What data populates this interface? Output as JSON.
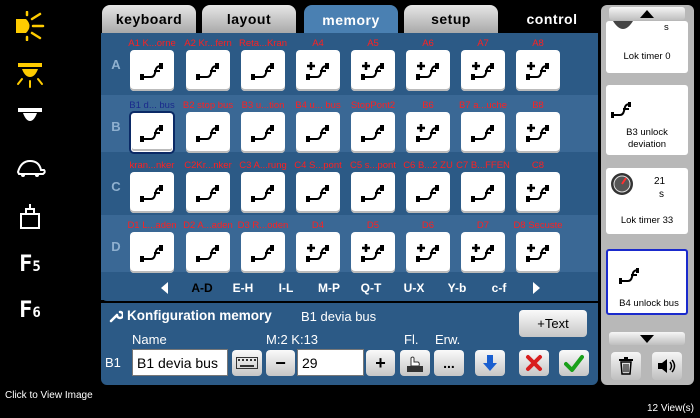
{
  "tabs": [
    {
      "label": "keyboard",
      "active": false
    },
    {
      "label": "layout",
      "active": false
    },
    {
      "label": "memory",
      "active": true
    },
    {
      "label": "setup",
      "active": false
    },
    {
      "label": "control",
      "active": false
    }
  ],
  "left_functions": [
    {
      "icon": "headlight-icon"
    },
    {
      "icon": "ceiling-light-icon"
    },
    {
      "icon": "lamp-icon"
    },
    {
      "icon": "turtle-icon"
    },
    {
      "icon": "weight-icon"
    },
    {
      "label": "F",
      "sub": "5"
    },
    {
      "label": "F",
      "sub": "6"
    }
  ],
  "rows": [
    {
      "letter": "A",
      "cells": [
        {
          "label": "A1 K...orne",
          "icon": "turnout"
        },
        {
          "label": "A2 Kr...fern",
          "icon": "turnout"
        },
        {
          "label": "Reta...Kran",
          "icon": "turnout"
        },
        {
          "label": "A4",
          "icon": "turnout-plus"
        },
        {
          "label": "A5",
          "icon": "turnout-plus"
        },
        {
          "label": "A6",
          "icon": "turnout-plus"
        },
        {
          "label": "A7",
          "icon": "turnout-plus"
        },
        {
          "label": "A8",
          "icon": "turnout-plus"
        }
      ]
    },
    {
      "letter": "B",
      "cells": [
        {
          "label": "B1 d... bus",
          "icon": "turnout",
          "selected": true
        },
        {
          "label": "B2 stop bus",
          "icon": "turnout"
        },
        {
          "label": "B3 u...tion",
          "icon": "turnout"
        },
        {
          "label": "B4 u... bus",
          "icon": "turnout"
        },
        {
          "label": "StopPont2",
          "icon": "turnout"
        },
        {
          "label": "B6",
          "icon": "turnout-plus"
        },
        {
          "label": "B7 a...uche",
          "icon": "turnout"
        },
        {
          "label": "B8",
          "icon": "turnout-plus"
        }
      ]
    },
    {
      "letter": "C",
      "cells": [
        {
          "label": "kran...nker",
          "icon": "turnout"
        },
        {
          "label": "C2Kr...nker",
          "icon": "turnout"
        },
        {
          "label": "C3 A...rung",
          "icon": "turnout"
        },
        {
          "label": "C4 S...pont",
          "icon": "turnout"
        },
        {
          "label": "C5 s...pont",
          "icon": "turnout"
        },
        {
          "label": "C6 B...2 ZU",
          "icon": "turnout"
        },
        {
          "label": "C7 B...FFEN",
          "icon": "turnout"
        },
        {
          "label": "C8",
          "icon": "turnout-plus"
        }
      ]
    },
    {
      "letter": "D",
      "cells": [
        {
          "label": "D1 L...aden",
          "icon": "turnout"
        },
        {
          "label": "D2 A...aden",
          "icon": "turnout"
        },
        {
          "label": "D3 R...oden",
          "icon": "turnout"
        },
        {
          "label": "D4",
          "icon": "turnout-plus"
        },
        {
          "label": "D5",
          "icon": "turnout-plus"
        },
        {
          "label": "D6",
          "icon": "turnout-plus"
        },
        {
          "label": "D7",
          "icon": "turnout-plus"
        },
        {
          "label": "D8 Secuste",
          "icon": "turnout-plus"
        }
      ]
    }
  ],
  "pages": [
    "A-D",
    "E-H",
    "I-L",
    "M-P",
    "Q-T",
    "U-X",
    "Y-b",
    "c-f"
  ],
  "active_page": "A-D",
  "help_label": "?",
  "config": {
    "title": "Konfiguration memory",
    "subtitle": "B1 devia bus",
    "add_text_label": "+Text",
    "name_label": "Name",
    "mk_label": "M:2 K:13",
    "fl_label": "Fl.",
    "erw_label": "Erw.",
    "slot_label": "B1",
    "name_value": "B1 devia bus",
    "number_value": "29",
    "minus_label": "−",
    "plus_label": "+",
    "erw_button": "..."
  },
  "right_panel": {
    "cards": [
      {
        "label": "Lok timer 0",
        "value": "s",
        "type": "timer-partial"
      },
      {
        "label": "B3 unlock deviation",
        "type": "turnout"
      },
      {
        "label": "Lok timer 33",
        "value": "21",
        "unit": "s",
        "type": "timer"
      },
      {
        "label": "B4 unlock bus",
        "type": "turnout",
        "selected": true
      }
    ]
  },
  "status": {
    "left": "Click to View Image",
    "right": "12 View(s)"
  },
  "colors": {
    "panel": "#2c5a86",
    "tab_active": "#4a80b2",
    "label_red": "#ff2020",
    "ok_green": "#1aa01a",
    "cancel_red": "#d81e1e",
    "down_blue": "#1a5fd0"
  }
}
